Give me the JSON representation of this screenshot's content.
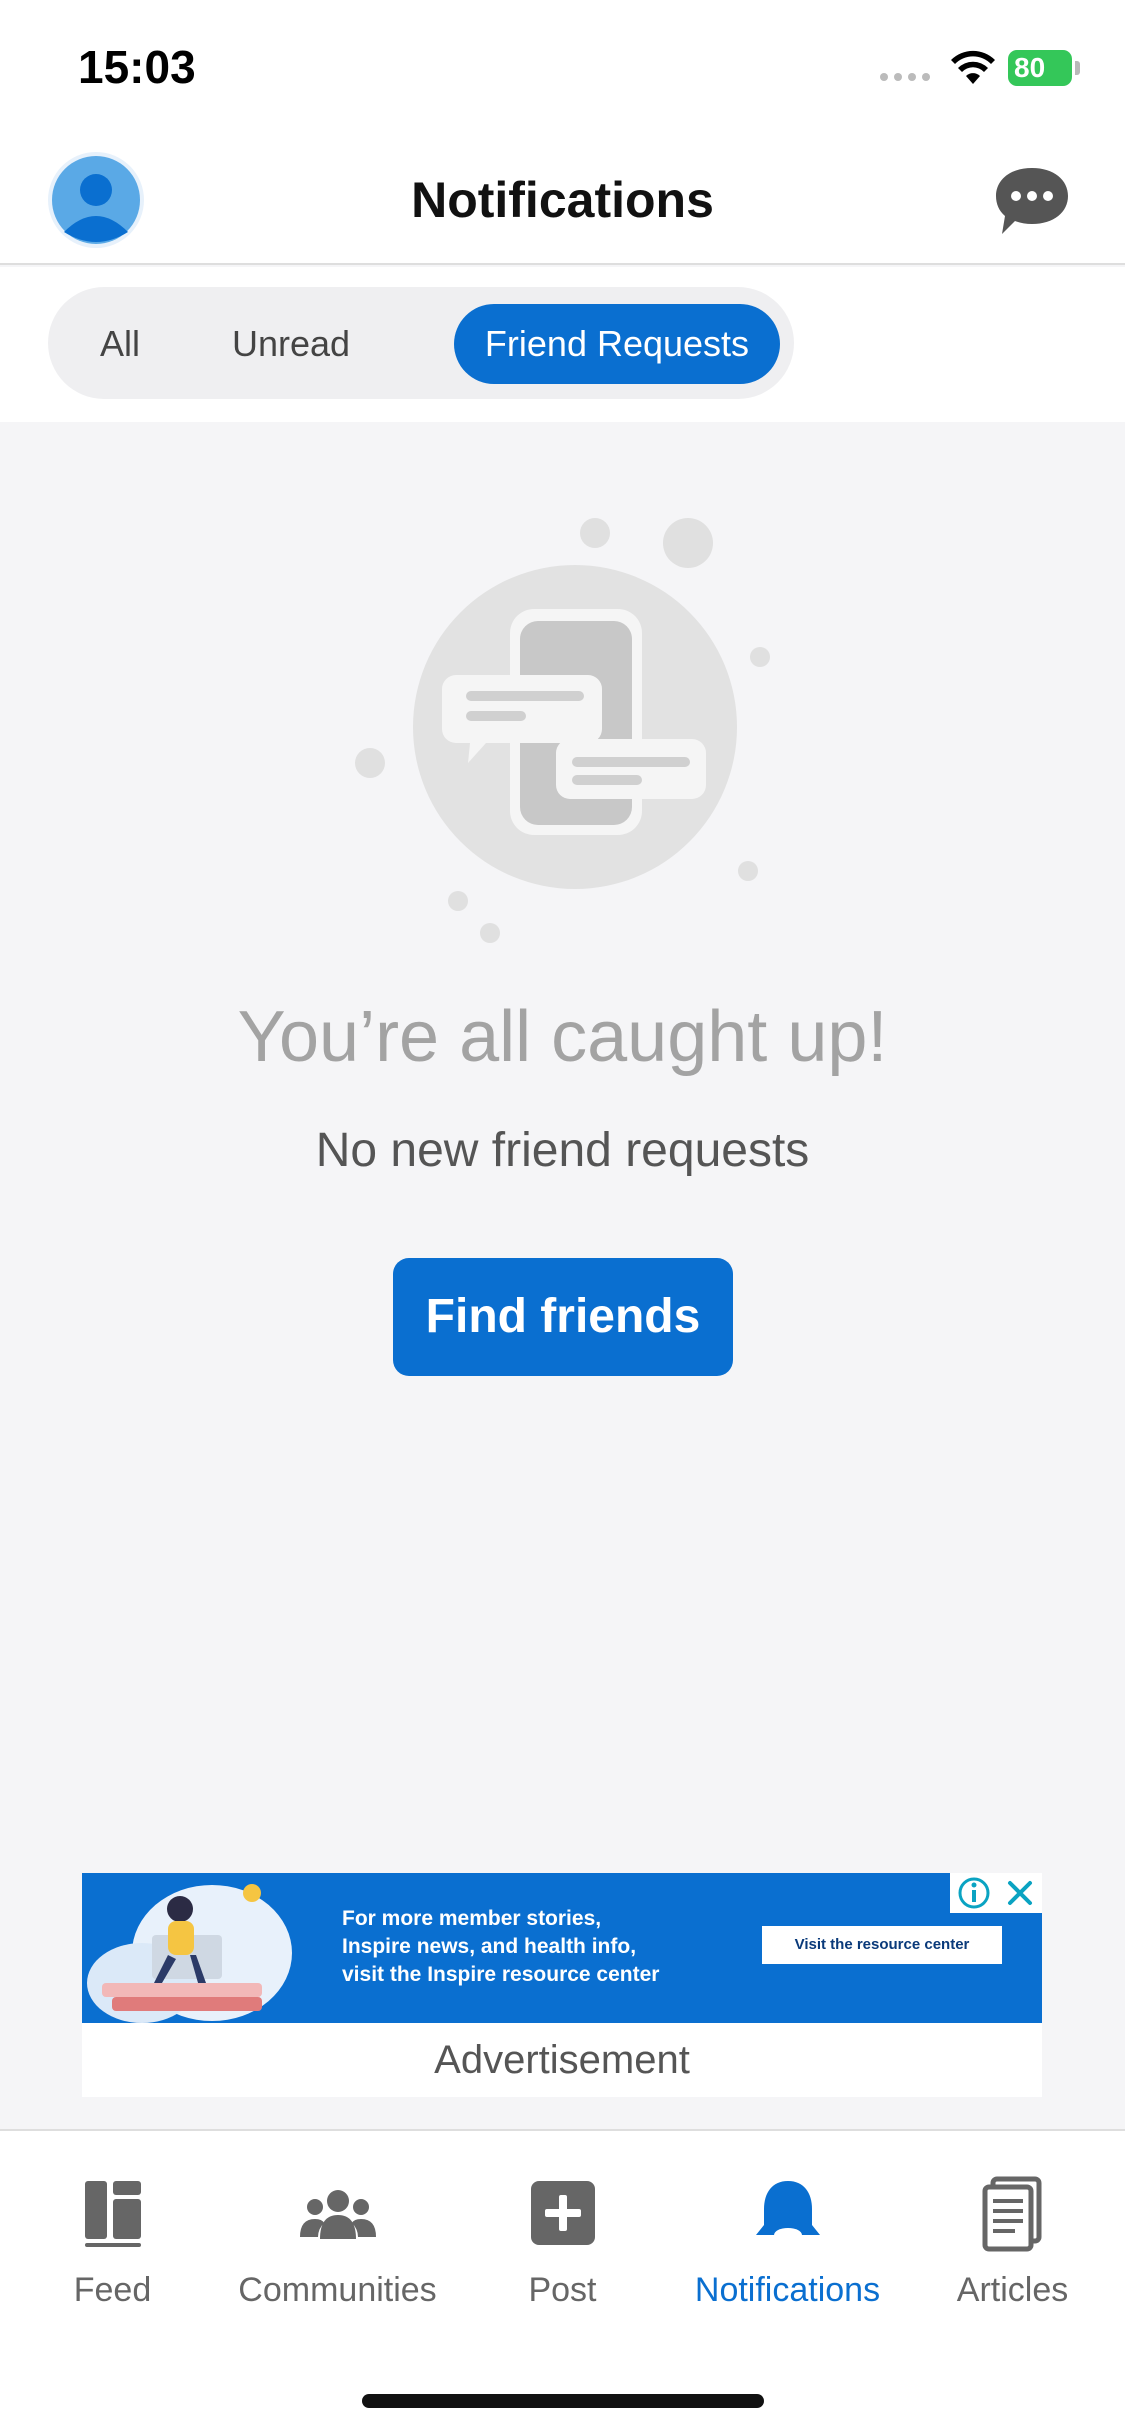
{
  "status_bar": {
    "time": "15:03",
    "battery": "80"
  },
  "header": {
    "title": "Notifications"
  },
  "tabs": [
    {
      "label": "All",
      "active": false
    },
    {
      "label": "Unread",
      "active": false
    },
    {
      "label": "Friend Requests",
      "active": true
    }
  ],
  "empty_state": {
    "title": "You’re all caught up!",
    "subtitle": "No new friend requests",
    "button_label": "Find friends"
  },
  "ad": {
    "text_lines": [
      "For more member stories,",
      "Inspire news, and health info,",
      "visit the Inspire resource center"
    ],
    "cta": "Visit the resource center",
    "label": "Advertisement"
  },
  "bottom_nav": {
    "items": [
      {
        "label": "Feed",
        "icon": "feed-icon",
        "active": false
      },
      {
        "label": "Communities",
        "icon": "communities-icon",
        "active": false
      },
      {
        "label": "Post",
        "icon": "post-plus-icon",
        "active": false
      },
      {
        "label": "Notifications",
        "icon": "bell-icon",
        "active": true
      },
      {
        "label": "Articles",
        "icon": "articles-icon",
        "active": false
      }
    ]
  },
  "colors": {
    "accent": "#0a6fd0",
    "battery": "#34c759",
    "background": "#f5f5f7"
  }
}
